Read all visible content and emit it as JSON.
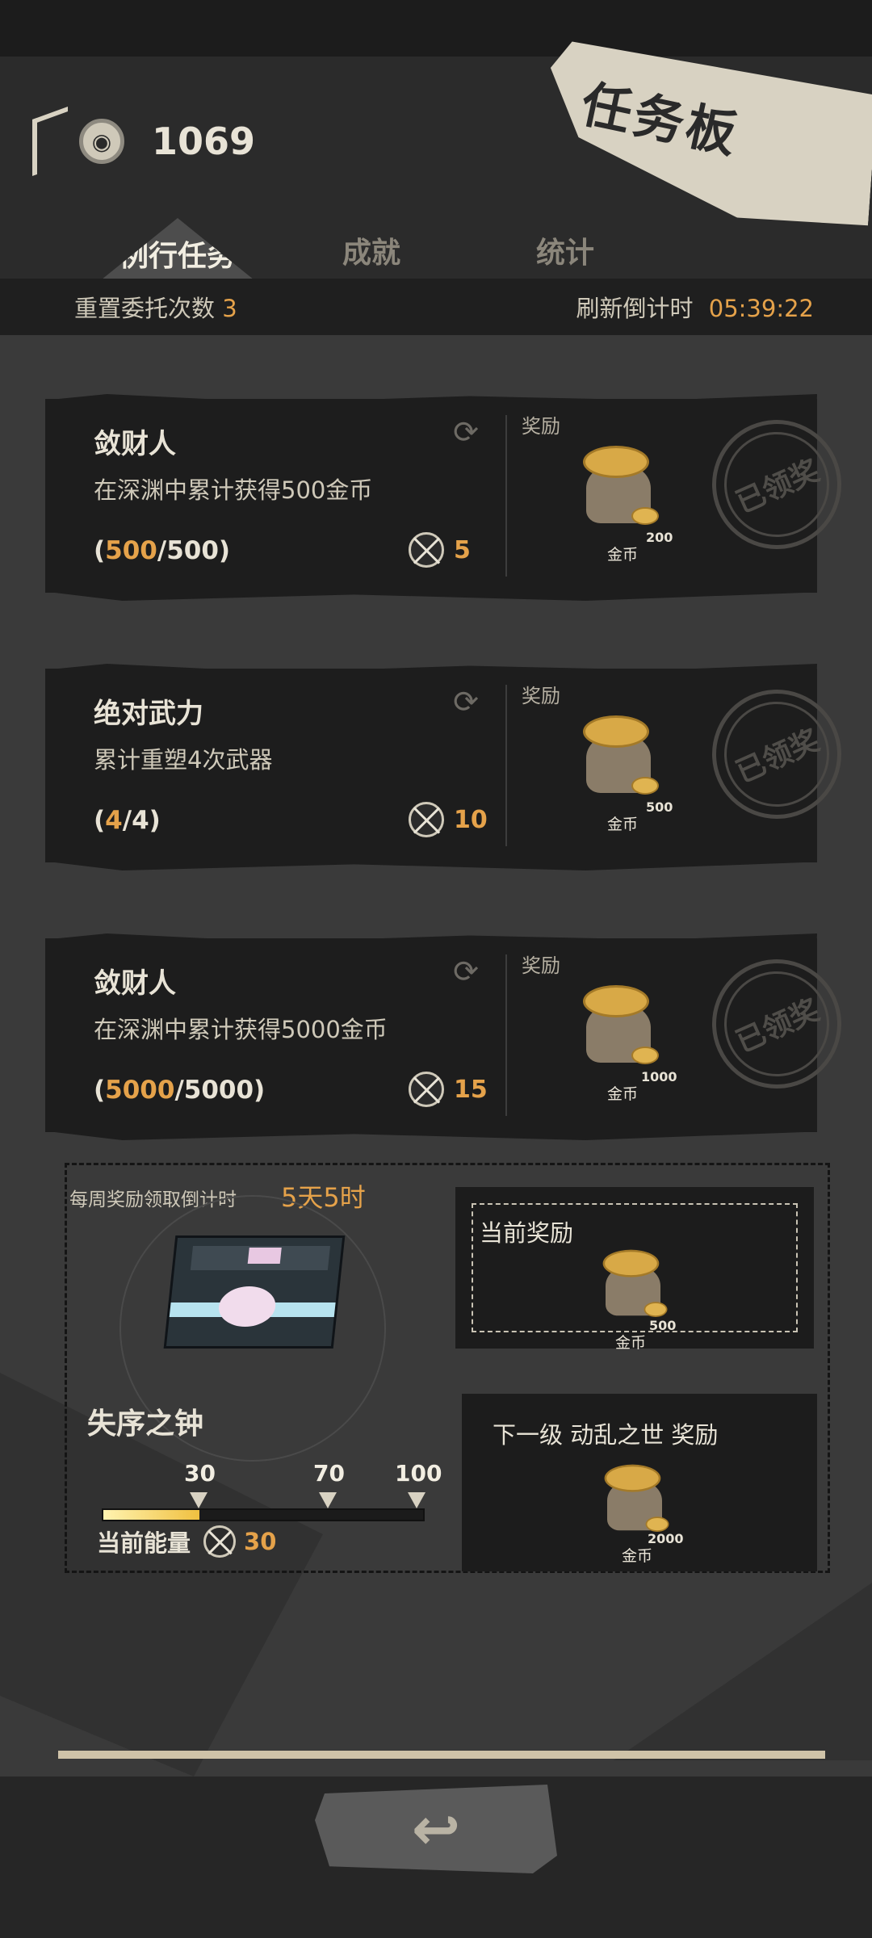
{
  "header": {
    "title": "任务板",
    "currency": {
      "icon": "eye-coin-icon",
      "value": "1069"
    }
  },
  "tabs": [
    {
      "label": "例行任务",
      "active": true
    },
    {
      "label": "成就",
      "active": false
    },
    {
      "label": "统计",
      "active": false
    }
  ],
  "subbar": {
    "reset_label": "重置委托次数",
    "reset_count": "3",
    "refresh_label": "刷新倒计时",
    "refresh_time": "05:39:22"
  },
  "tasks": [
    {
      "name": "敛财人",
      "description": "在深渊中累计获得500金币",
      "progress_open": "(",
      "progress_current": "500",
      "progress_total": "/500)",
      "points": "5",
      "reward_label": "奖励",
      "reward_amount": "200",
      "reward_name": "金币",
      "stamp": "已领奖"
    },
    {
      "name": "绝对武力",
      "description": "累计重塑4次武器",
      "progress_open": "(",
      "progress_current": "4",
      "progress_total": "/4)",
      "points": "10",
      "reward_label": "奖励",
      "reward_amount": "500",
      "reward_name": "金币",
      "stamp": "已领奖"
    },
    {
      "name": "敛财人",
      "description": "在深渊中累计获得5000金币",
      "progress_open": "(",
      "progress_current": "5000",
      "progress_total": "/5000)",
      "points": "15",
      "reward_label": "奖励",
      "reward_amount": "1000",
      "reward_name": "金币",
      "stamp": "已领奖"
    }
  ],
  "weekly": {
    "countdown_label": "每周奖励领取倒计时",
    "countdown_value": "5天5时",
    "item_name": "失序之钟",
    "thresholds": [
      "30",
      "70",
      "100"
    ],
    "max_energy": 100,
    "energy_label": "当前能量",
    "energy_value": "30",
    "energy_fraction": 0.3,
    "current_reward": {
      "label": "当前奖励",
      "amount": "500",
      "name": "金币"
    },
    "next_reward": {
      "label": "下一级  动乱之世  奖励",
      "amount": "2000",
      "name": "金币"
    }
  },
  "colors": {
    "accent": "#e5a24a",
    "paper": "#d8d2c2",
    "panel": "#1d1d1d"
  },
  "footer": {
    "back_icon": "back-arrow-icon"
  }
}
